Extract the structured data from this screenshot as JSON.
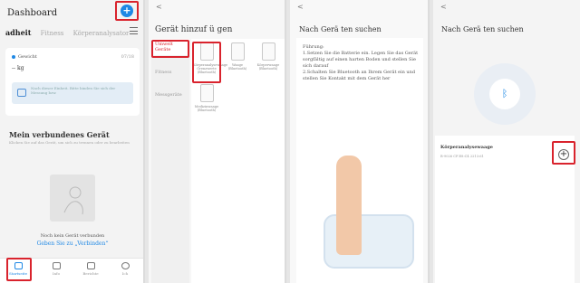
{
  "p1": {
    "title": "Dashboard",
    "plus": "+",
    "tabs": [
      "adheit",
      "Fitness",
      "Körperanalysator"
    ],
    "weight_label": "Gewicht",
    "weight_date": "07/18",
    "weight_value": "-- kg",
    "hint": "Nach dieser Einheit. Bitte binden Sie sich der Messung bzw.",
    "section_title": "Mein verbundenes Gerät",
    "section_sub": "Klicken Sie auf das Gerät, um sich zu trennen oder zu bearbeiten",
    "no_device": "Noch kein Gerät verbunden",
    "connect": "Geben Sie zu „Verbinden“",
    "nav": [
      "Startseite",
      "Info",
      "Berichte",
      "Ich"
    ]
  },
  "p2": {
    "back": "<",
    "title": "Gerät hinzuf ü gen",
    "categories": [
      "Umwelt Geräte",
      "Fitness",
      "Messgeräte"
    ],
    "devices": [
      "Körperanalysewaage Grenzwerte (Bluetooth)",
      "Waage (Bluetooth)",
      "Körperwaage (Bluetooth)",
      "Medizinwaage (Bluetooth)"
    ]
  },
  "p3": {
    "back": "<",
    "title": "Nach Gerä ten suchen",
    "tips": "Führung:\n1.Setzen Sie die Batterie ein. Legen Sie das Gerät sorgfältig auf einen harten Boden und stellen Sie sich darauf\n2.Schalten Sie Bluetooth an Ihrem Gerät ein und stellen Sie Kontakt mit dem Gerät her"
  },
  "p4": {
    "back": "<",
    "title": "Nach Gerä ten suchen",
    "found_name": "Körperanalysewaage",
    "found_id": "B-9026 CF:E8:C4 2213:61",
    "bt": "ᛒ",
    "add": "+"
  },
  "colors": {
    "accent": "#1e88e5",
    "highlight": "#d9232d"
  }
}
